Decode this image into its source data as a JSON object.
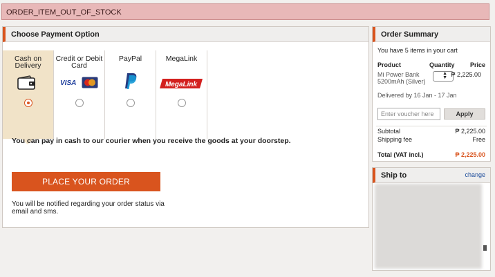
{
  "error": {
    "message": "ORDER_ITEM_OUT_OF_STOCK"
  },
  "payment": {
    "title": "Choose Payment Option",
    "methods": [
      {
        "label": "Cash on Delivery",
        "icon": "wallet-icon",
        "selected": true
      },
      {
        "label": "Credit or Debit Card",
        "icon": "visa-mastercard-icon",
        "selected": false
      },
      {
        "label": "PayPal",
        "icon": "paypal-icon",
        "selected": false
      },
      {
        "label": "MegaLink",
        "icon": "megalink-icon",
        "selected": false
      }
    ],
    "info": "You can pay in cash to our courier when you receive the goods at your doorstep.",
    "place_order": "PLACE YOUR ORDER",
    "notify": "You will be notified regarding your order status via email and sms."
  },
  "summary": {
    "title": "Order Summary",
    "count": "You have 5 items in your cart",
    "col_product": "Product",
    "col_quantity": "Quantity",
    "col_price": "Price",
    "item_name": "Mi Power Bank 5200mAh (Silver)",
    "item_price": "₱ 2,225.00",
    "delivery": "Delivered by 16 Jan - 17 Jan",
    "voucher_placeholder": "Enter voucher here",
    "apply": "Apply",
    "subtotal_label": "Subtotal",
    "subtotal_value": "₱ 2,225.00",
    "shipping_label": "Shipping fee",
    "shipping_value": "Free",
    "total_label": "Total (VAT incl.)",
    "total_value": "₱ 2,225.00"
  },
  "ship": {
    "title": "Ship to",
    "change": "change"
  },
  "colors": {
    "accent": "#d9541e",
    "selected_bg": "#f1e3c8",
    "error_bg": "#e8b8b8"
  }
}
